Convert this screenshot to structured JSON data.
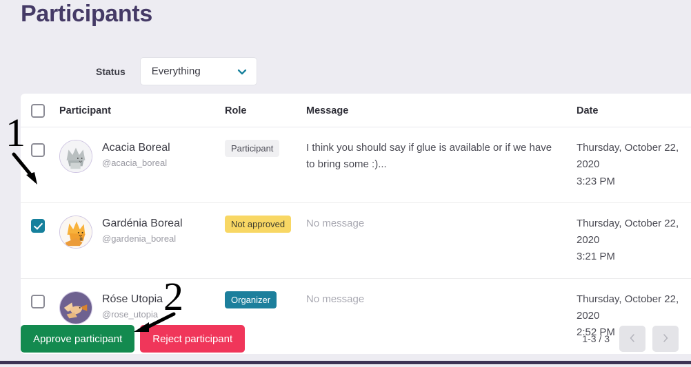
{
  "page": {
    "title": "Participants",
    "background_color": "#edecf2",
    "title_color": "#453a66"
  },
  "filter": {
    "label": "Status",
    "select_value": "Everything",
    "select_icon": "chevron-down-icon",
    "chevron_color": "#16809c"
  },
  "table": {
    "headers": {
      "select_all": "",
      "participant": "Participant",
      "role": "Role",
      "message": "Message",
      "date": "Date"
    },
    "rows": [
      {
        "checked": false,
        "name": "Acacia Boreal",
        "handle": "@acacia_boreal",
        "avatar": "grey-fox-avatar",
        "role": "Participant",
        "role_style": "grey",
        "message": "I think you should say if glue is available or if we have to bring some :)...",
        "message_empty": false,
        "date_line1": "Thursday, October 22,",
        "date_line2": "2020",
        "date_line3": "3:23 PM"
      },
      {
        "checked": true,
        "name": "Gardénia Boreal",
        "handle": "@gardenia_boreal",
        "avatar": "orange-fox-avatar",
        "role": "Not approved",
        "role_style": "yellow",
        "message": "No message",
        "message_empty": true,
        "date_line1": "Thursday, October 22,",
        "date_line2": "2020",
        "date_line3": "3:21 PM"
      },
      {
        "checked": false,
        "name": "Róse Utopia",
        "handle": "@rose_utopia",
        "avatar": "purple-bird-avatar",
        "role": "Organizer",
        "role_style": "teal",
        "message": "No message",
        "message_empty": true,
        "date_line1": "Thursday, October 22,",
        "date_line2": "2020",
        "date_line3": "2:52 PM"
      }
    ]
  },
  "actions": {
    "approve_label": "Approve participant",
    "reject_label": "Reject participant",
    "approve_color": "#138a4f",
    "reject_color": "#f0365a"
  },
  "pagination": {
    "range_label": "1-3 / 3",
    "prev_icon": "chevron-left-icon",
    "next_icon": "chevron-right-icon"
  },
  "annotations": [
    {
      "label": "1"
    },
    {
      "label": "2"
    }
  ]
}
